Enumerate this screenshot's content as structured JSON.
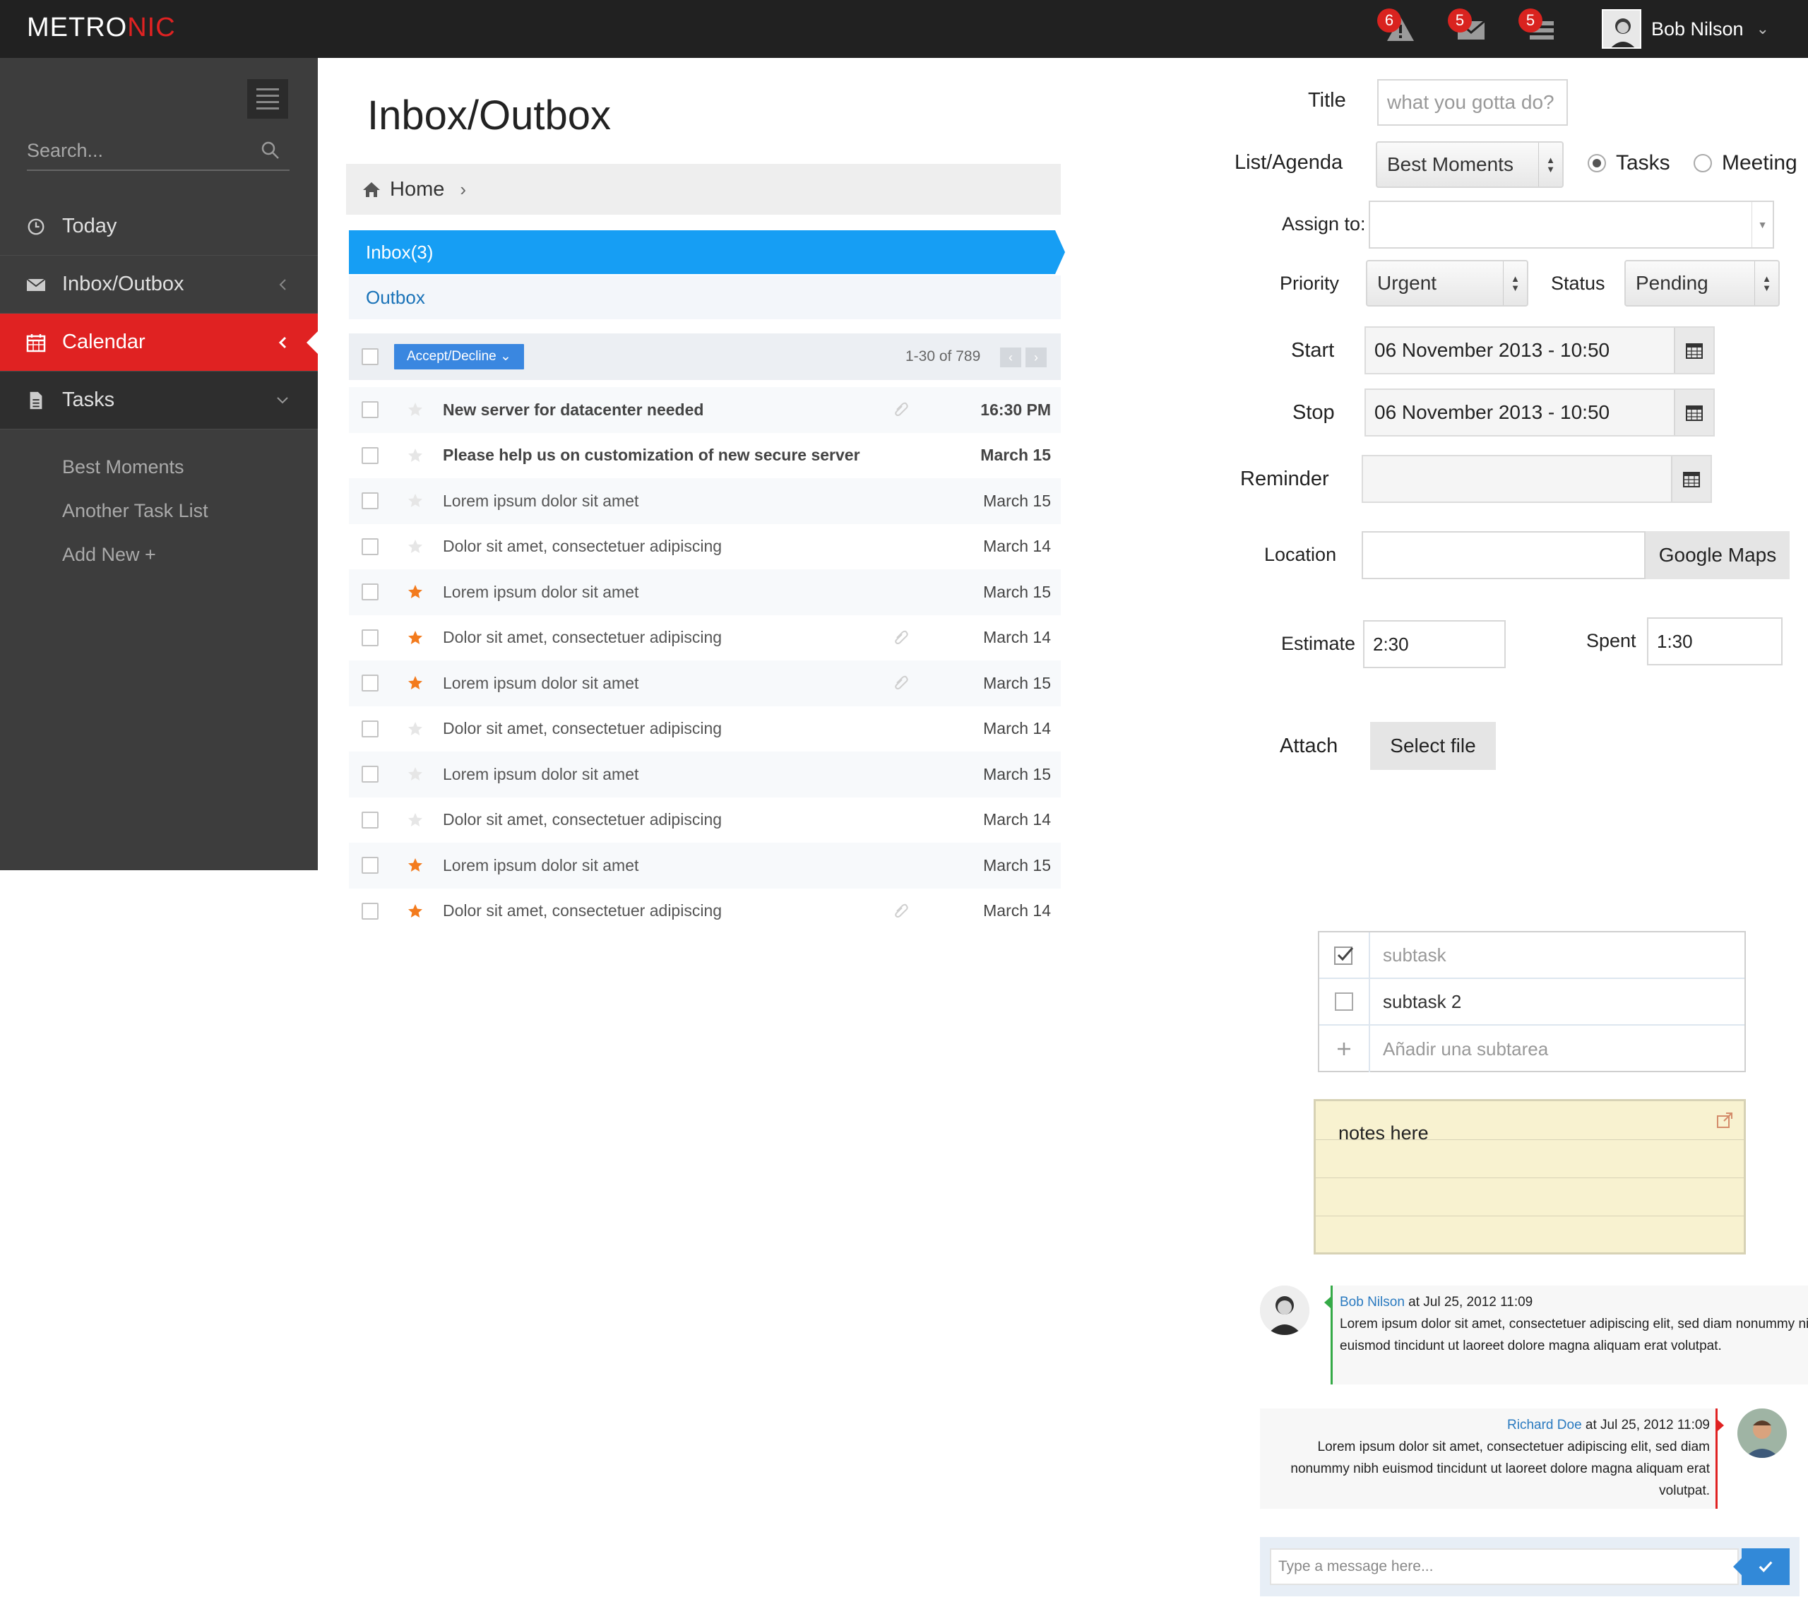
{
  "brand": {
    "name_main": "METRO",
    "name_accent": "NIC"
  },
  "topbar": {
    "notifications": [
      {
        "icon": "warning-icon",
        "count": "6"
      },
      {
        "icon": "envelope-icon",
        "count": "5"
      },
      {
        "icon": "tasks-icon",
        "count": "5"
      }
    ],
    "user_name": "Bob Nilson"
  },
  "sidebar": {
    "search_placeholder": "Search...",
    "items": [
      {
        "label": "Today",
        "icon": "clock-icon"
      },
      {
        "label": "Inbox/Outbox",
        "icon": "envelope-icon"
      },
      {
        "label": "Calendar",
        "icon": "calendar-icon"
      },
      {
        "label": "Tasks",
        "icon": "file-icon"
      }
    ],
    "subitems": [
      "Best Moments",
      "Another Task List",
      "Add New +"
    ]
  },
  "main": {
    "title": "Inbox/Outbox",
    "breadcrumb_home": "Home",
    "tab_inbox": "Inbox(3)",
    "tab_outbox": "Outbox",
    "accept_decline": "Accept/Decline",
    "pager": "1-30 of 789",
    "mails": [
      {
        "subject": "New server for datacenter needed",
        "date": "16:30 PM",
        "unread": true,
        "starred": false,
        "attachment": true
      },
      {
        "subject": "Please help us on customization of new secure server",
        "date": "March 15",
        "unread": true,
        "starred": false,
        "attachment": false
      },
      {
        "subject": "Lorem ipsum dolor sit amet",
        "date": "March 15",
        "unread": false,
        "starred": false,
        "attachment": false
      },
      {
        "subject": "Dolor sit amet, consectetuer adipiscing",
        "date": "March 14",
        "unread": false,
        "starred": false,
        "attachment": false
      },
      {
        "subject": "Lorem ipsum dolor sit amet",
        "date": "March 15",
        "unread": false,
        "starred": true,
        "attachment": false
      },
      {
        "subject": "Dolor sit amet, consectetuer adipiscing",
        "date": "March 14",
        "unread": false,
        "starred": true,
        "attachment": true
      },
      {
        "subject": "Lorem ipsum dolor sit amet",
        "date": "March 15",
        "unread": false,
        "starred": true,
        "attachment": true
      },
      {
        "subject": "Dolor sit amet, consectetuer adipiscing",
        "date": "March 14",
        "unread": false,
        "starred": false,
        "attachment": false
      },
      {
        "subject": "Lorem ipsum dolor sit amet",
        "date": "March 15",
        "unread": false,
        "starred": false,
        "attachment": false
      },
      {
        "subject": "Dolor sit amet, consectetuer adipiscing",
        "date": "March 14",
        "unread": false,
        "starred": false,
        "attachment": false
      },
      {
        "subject": "Lorem ipsum dolor sit amet",
        "date": "March 15",
        "unread": false,
        "starred": true,
        "attachment": false
      },
      {
        "subject": "Dolor sit amet, consectetuer adipiscing",
        "date": "March 14",
        "unread": false,
        "starred": true,
        "attachment": true
      }
    ]
  },
  "form": {
    "title_label": "Title",
    "title_placeholder": "what you gotta do?",
    "list_label": "List/Agenda",
    "list_value": "Best Moments",
    "radio_tasks": "Tasks",
    "radio_meeting": "Meeting",
    "assign_label": "Assign to:",
    "assign_value": "",
    "priority_label": "Priority",
    "priority_value": "Urgent",
    "status_label": "Status",
    "status_value": "Pending",
    "start_label": "Start",
    "start_value": "06 November 2013 - 10:50",
    "stop_label": "Stop",
    "stop_value": "06 November 2013 - 10:50",
    "reminder_label": "Reminder",
    "reminder_value": "",
    "location_label": "Location",
    "location_value": "",
    "maps_button": "Google Maps",
    "estimate_label": "Estimate",
    "estimate_value": "2:30",
    "spent_label": "Spent",
    "spent_value": "1:30",
    "attach_label": "Attach",
    "select_file": "Select file"
  },
  "subtasks": [
    {
      "text": "subtask",
      "checked": true
    },
    {
      "text": "subtask 2",
      "checked": false
    }
  ],
  "subtask_add_placeholder": "Añadir una subtarea",
  "notes": "notes here",
  "chat": {
    "messages": [
      {
        "name": "Bob Nilson",
        "time": "at Jul 25, 2012 11:09",
        "text": "Lorem ipsum dolor sit amet, consectetuer adipiscing elit, sed diam nonummy nibh euismod tincidunt ut laoreet dolore magna aliquam erat volutpat."
      },
      {
        "name": "Richard Doe",
        "time": "at Jul 25, 2012 11:09",
        "text": "Lorem ipsum dolor sit amet, consectetuer adipiscing elit, sed diam nonummy nibh euismod tincidunt ut laoreet dolore magna aliquam erat volutpat."
      }
    ],
    "input_placeholder": "Type a message here..."
  },
  "colors": {
    "accent": "#e02222",
    "inbox_tab": "#169ef4",
    "star": "#f37b1d"
  }
}
